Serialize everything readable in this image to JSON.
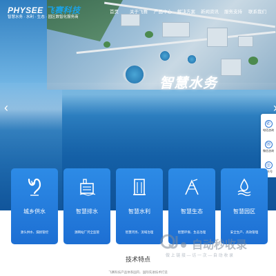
{
  "header": {
    "logo_brand_left": "PHYSEE",
    "logo_brand_right": "飞赛科技",
    "logo_slogan": "智慧水务 · 水利 · 生态 · 园区数智化服务商",
    "nav": [
      "首页",
      "关于飞赛",
      "产品中心",
      "解决方案",
      "新闻资讯",
      "服务支持",
      "联系我们"
    ]
  },
  "hero": {
    "title": "智慧水务",
    "prev_glyph": "‹",
    "next_glyph": "›"
  },
  "side_bar": {
    "items": [
      {
        "label": "电话咨询",
        "icon": "phone-icon",
        "glyph": "✆"
      },
      {
        "label": "微信咨询",
        "icon": "wechat-icon",
        "glyph": "✉"
      },
      {
        "label": "公众号",
        "icon": "qrcode-icon",
        "glyph": "◎"
      }
    ]
  },
  "cards": [
    {
      "title": "城乡供水",
      "desc": "源头供水、漏损管控",
      "icon": "water-supply-icon"
    },
    {
      "title": "智慧排水",
      "desc": "源网站厂河全监管",
      "icon": "drainage-icon"
    },
    {
      "title": "智慧水利",
      "desc": "智慧河务、流域治理",
      "icon": "water-conservancy-icon"
    },
    {
      "title": "智慧生态",
      "desc": "智慧环保、生态治理",
      "icon": "ecology-icon"
    },
    {
      "title": "智慧园区",
      "desc": "安全生产、高效管理",
      "icon": "park-icon"
    }
  ],
  "features": {
    "title": "技术特点",
    "subtitle": "飞赛科技产品体系国内、国际先进技术打造"
  },
  "watermark": {
    "title": "自动秒收录",
    "subtitle": "做 上 链 接 — 访 一 次 — 自 动 收 录"
  },
  "colors": {
    "card_blue": "#1d6fd3",
    "accent": "#1aa3e8",
    "side_icon": "#2a74d4"
  }
}
